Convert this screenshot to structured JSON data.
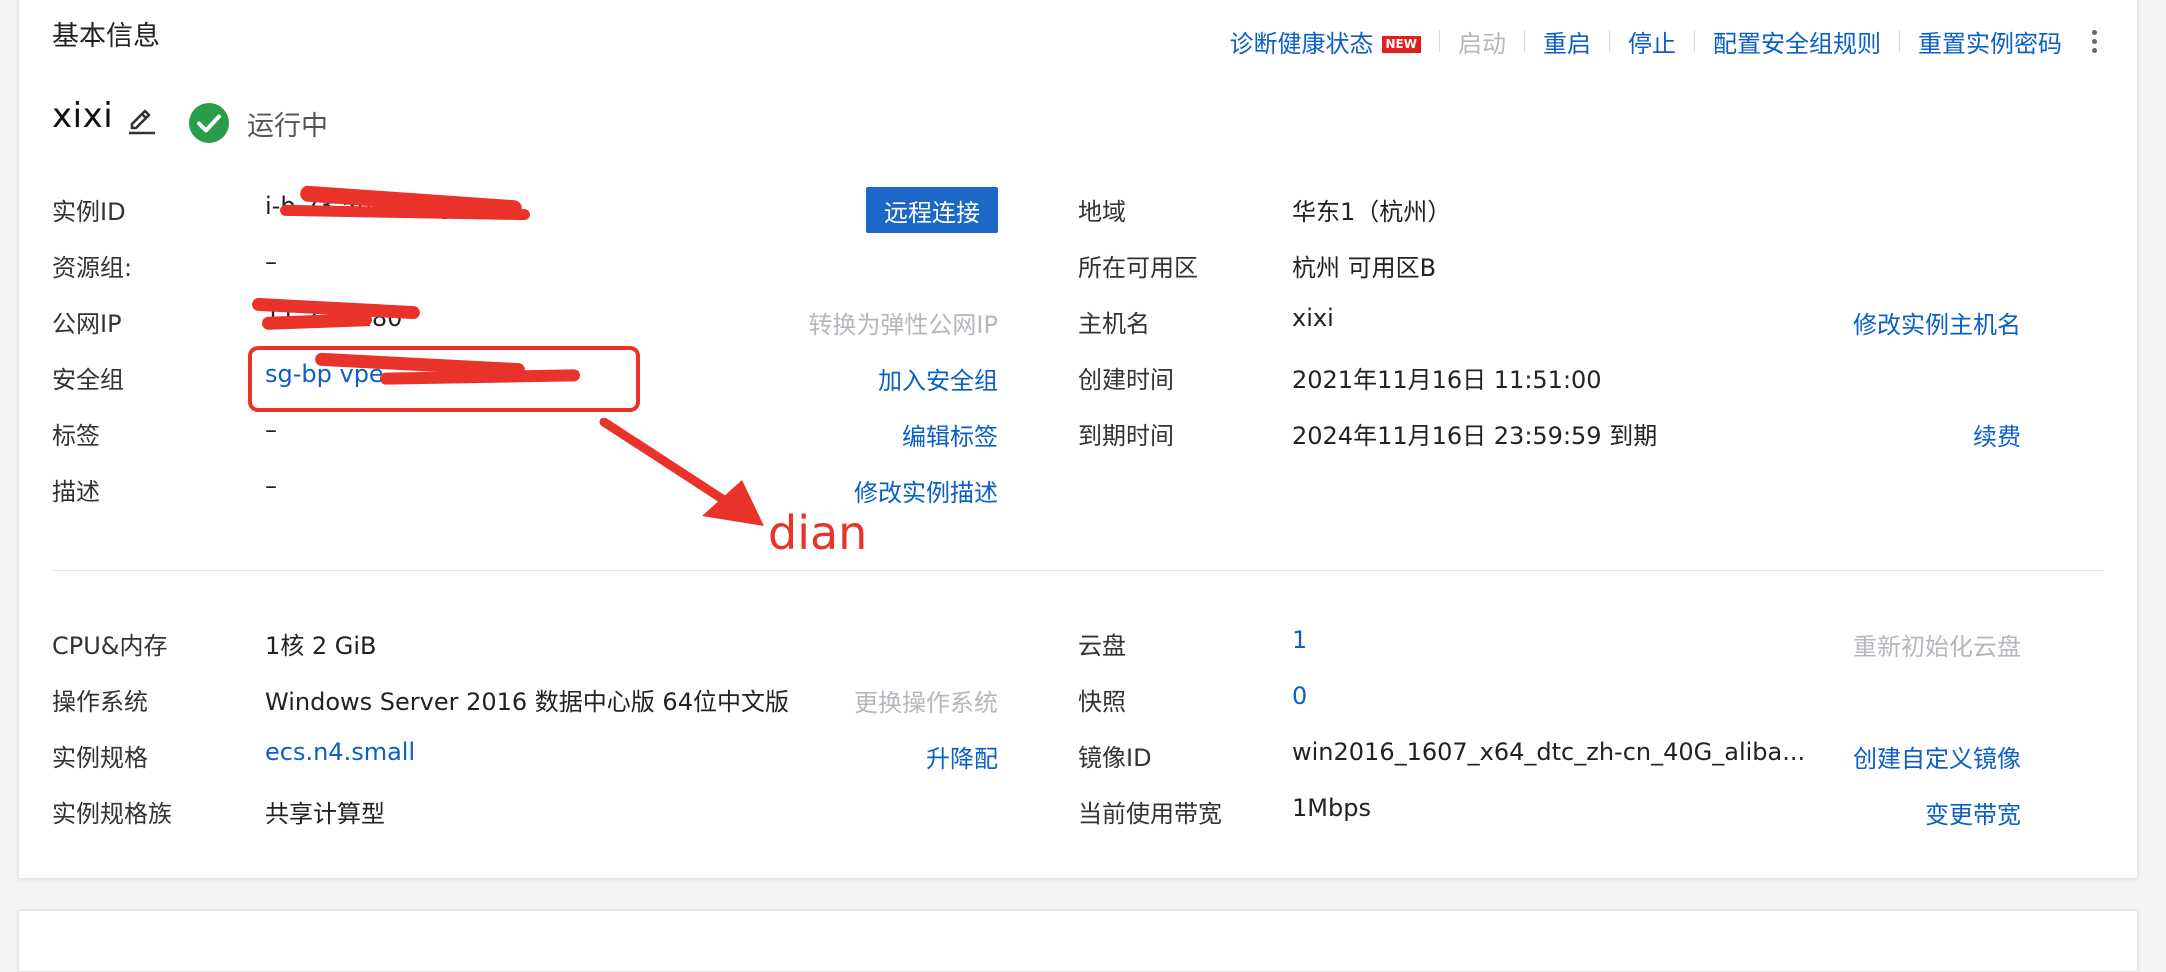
{
  "section_title": "基本信息",
  "toolbar": {
    "diagnose": "诊断健康状态",
    "new_badge": "NEW",
    "start": "启动",
    "restart": "重启",
    "stop": "停止",
    "security_rules": "配置安全组规则",
    "reset_password": "重置实例密码"
  },
  "instance": {
    "name": "xixi",
    "status": "运行中"
  },
  "left_info": {
    "instance_id": {
      "label": "实例ID",
      "value": "i-b 23 5h wumges",
      "action": "远程连接"
    },
    "resource_group": {
      "label": "资源组:",
      "value": "–"
    },
    "public_ip": {
      "label": "公网IP",
      "value": "11 333.180",
      "action": "转换为弹性公网IP"
    },
    "security_group": {
      "label": "安全组",
      "value": "sg-bp  vpe",
      "action": "加入安全组"
    },
    "tags": {
      "label": "标签",
      "value": "–",
      "action": "编辑标签"
    },
    "description": {
      "label": "描述",
      "value": "–",
      "action": "修改实例描述"
    }
  },
  "right_info": {
    "region": {
      "label": "地域",
      "value": "华东1（杭州）"
    },
    "zone": {
      "label": "所在可用区",
      "value": "杭州 可用区B"
    },
    "hostname": {
      "label": "主机名",
      "value": "xixi",
      "action": "修改实例主机名"
    },
    "created": {
      "label": "创建时间",
      "value": "2021年11月16日 11:51:00"
    },
    "expires": {
      "label": "到期时间",
      "value": "2024年11月16日 23:59:59 到期",
      "action": "续费"
    }
  },
  "spec_left": {
    "cpu_mem": {
      "label": "CPU&内存",
      "value": "1核 2 GiB"
    },
    "os": {
      "label": "操作系统",
      "value": "Windows Server 2016 数据中心版 64位中文版",
      "action": "更换操作系统"
    },
    "instance_type": {
      "label": "实例规格",
      "value": "ecs.n4.small",
      "action": "升降配"
    },
    "type_family": {
      "label": "实例规格族",
      "value": "共享计算型"
    }
  },
  "spec_right": {
    "disks": {
      "label": "云盘",
      "value": "1",
      "action": "重新初始化云盘"
    },
    "snapshots": {
      "label": "快照",
      "value": "0"
    },
    "image_id": {
      "label": "镜像ID",
      "value": "win2016_1607_x64_dtc_zh-cn_40G_aliba...",
      "action": "创建自定义镜像"
    },
    "bandwidth": {
      "label": "当前使用带宽",
      "value": "1Mbps",
      "action": "变更带宽"
    }
  },
  "annotation": {
    "text": "dian",
    "color": "#e8322a"
  },
  "colors": {
    "link": "#0b5fc6",
    "primary_button": "#1c67c7",
    "status_ok": "#2a9d4a",
    "disabled": "#b4b7bc"
  }
}
